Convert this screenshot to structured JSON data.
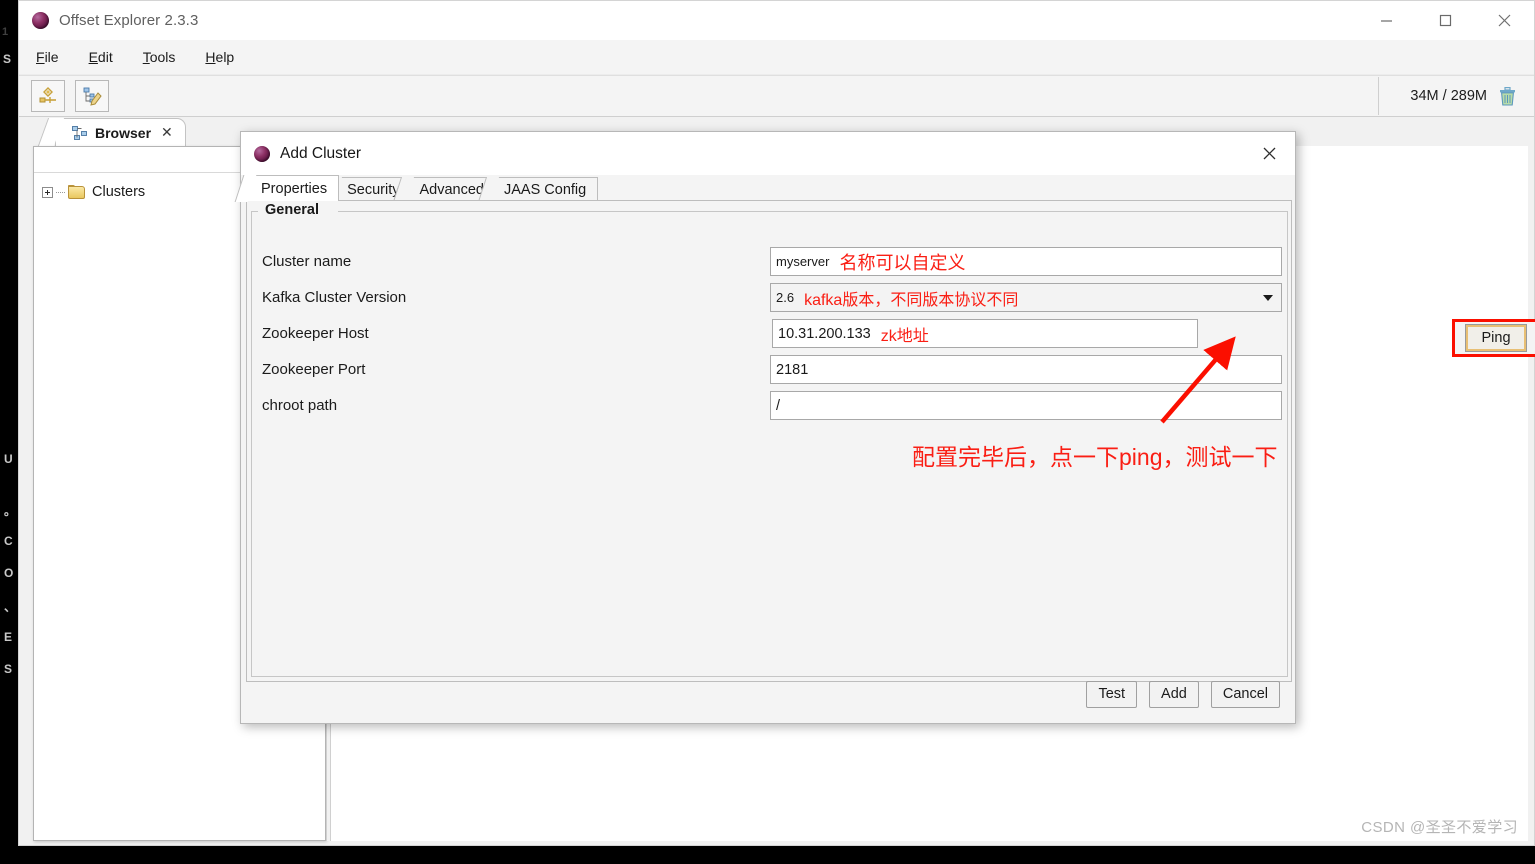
{
  "window": {
    "title": "Offset Explorer  2.3.3",
    "app_icon": "sphere-icon",
    "controls": {
      "minimize": "minimize-icon",
      "maximize": "maximize-icon",
      "close": "close-icon"
    }
  },
  "menu": {
    "items": [
      {
        "mnemonic": "F",
        "rest": "ile"
      },
      {
        "mnemonic": "E",
        "rest": "dit"
      },
      {
        "mnemonic": "T",
        "rest": "ools"
      },
      {
        "mnemonic": "H",
        "rest": "elp"
      }
    ]
  },
  "toolbar": {
    "buttons": [
      {
        "name": "add-connection-button",
        "icon": "connector-icon"
      },
      {
        "name": "edit-tree-button",
        "icon": "tree-pencil-icon"
      }
    ],
    "memory": {
      "text": "34M / 289M",
      "trash_icon": "trash-icon"
    }
  },
  "editor_tab": {
    "label": "Browser",
    "icon": "browser-tree-icon",
    "close": "✕"
  },
  "tree": {
    "root_label": "Clusters",
    "folder_icon": "folder-icon",
    "expander": "plus-expander-icon"
  },
  "dialog": {
    "title": "Add Cluster",
    "icon": "sphere-icon",
    "close": "✕",
    "tabs": [
      {
        "label": "Properties",
        "active": true
      },
      {
        "label": "Security",
        "active": false
      },
      {
        "label": "Advanced",
        "active": false
      },
      {
        "label": "JAAS Config",
        "active": false
      }
    ],
    "group_label": "General",
    "fields": [
      {
        "label": "Cluster name",
        "value": "myserver",
        "annotation": "名称可以自定义",
        "kind": "text"
      },
      {
        "label": "Kafka Cluster Version",
        "value": "2.6",
        "annotation": "kafka版本，不同版本协议不同",
        "kind": "combo"
      },
      {
        "label": "Zookeeper Host",
        "value": "10.31.200.133",
        "annotation": "zk地址",
        "kind": "text-with-ping"
      },
      {
        "label": "Zookeeper Port",
        "value": "2181",
        "annotation": "",
        "kind": "text"
      },
      {
        "label": "chroot path",
        "value": "/",
        "annotation": "",
        "kind": "text"
      }
    ],
    "ping_label": "Ping",
    "note": "配置完毕后，点一下ping，测试一下",
    "footer_buttons": [
      "Test",
      "Add",
      "Cancel"
    ]
  },
  "watermark": "CSDN @圣圣不爱学习",
  "colors": {
    "annotation_red": "#fa1e14",
    "highlight_red": "#fb0f00",
    "window_bg": "#f1f1f1",
    "dialog_bg": "#f4f4f4"
  },
  "desktop_ghost": {
    "top": [
      "1",
      "S"
    ],
    "column": [
      "U",
      "。",
      "C",
      "O",
      "、",
      "E",
      "S"
    ]
  }
}
